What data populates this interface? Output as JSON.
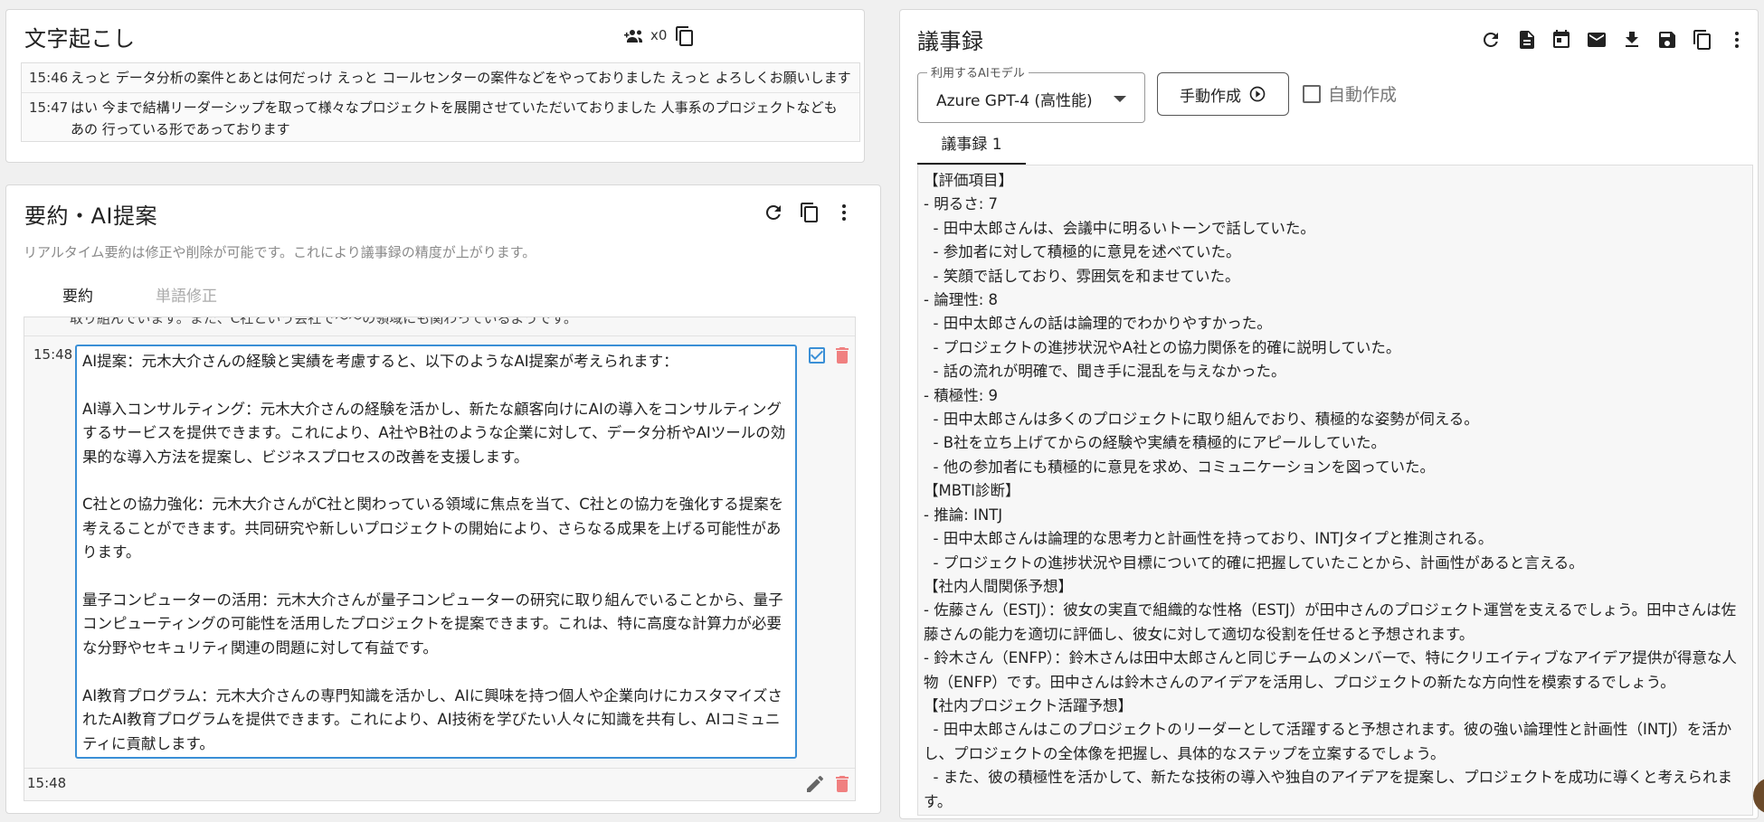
{
  "transcript": {
    "title": "文字起こし",
    "speaker_count": "x0",
    "rows": [
      {
        "time": "15:46",
        "text": "えっと データ分析の案件とあとは何だっけ えっと コールセンターの案件などをやっておりました えっと よろしくお願いします"
      },
      {
        "time": "15:47",
        "text": "はい 今まで結構リーダーシップを取って様々なプロジェクトを展開させていただいておりました 人事系のプロジェクトなども あの 行っている形であっております"
      }
    ]
  },
  "summary": {
    "title": "要約・AI提案",
    "subtitle": "リアルタイム要約は修正や削除が可能です。これにより議事録の精度が上がります。",
    "tabs": [
      {
        "label": "要約"
      },
      {
        "label": "単語修正"
      }
    ],
    "cut_text": "取り組んでいます。また、C社という会社で〜〜の領域にも関わっているようです。",
    "editing": {
      "time": "15:48",
      "text": "AI提案：元木大介さんの経験と実績を考慮すると、以下のようなAI提案が考えられます：\n\nAI導入コンサルティング：元木大介さんの経験を活かし、新たな顧客向けにAIの導入をコンサルティングするサービスを提供できます。これにより、A社やB社のような企業に対して、データ分析やAIツールの効果的な導入方法を提案し、ビジネスプロセスの改善を支援します。\n\nC社との協力強化：元木大介さんがC社と関わっている領域に焦点を当て、C社との協力を強化する提案を考えることができます。共同研究や新しいプロジェクトの開始により、さらなる成果を上げる可能性があります。\n\n量子コンピューターの活用：元木大介さんが量子コンピューターの研究に取り組んでいることから、量子コンピューティングの可能性を活用したプロジェクトを提案できます。これは、特に高度な計算力が必要な分野やセキュリティ関連の問題に対して有益です。\n\nAI教育プログラム：元木大介さんの専門知識を活かし、AIに興味を持つ個人や企業向けにカスタマイズされたAI教育プログラムを提供できます。これにより、AI技術を学びたい人々に知識を共有し、AIコミュニティに貢献します。"
    },
    "next_time": "15:48"
  },
  "minutes": {
    "title": "議事録",
    "model_label": "利用するAIモデル",
    "model_value": "Azure GPT-4 (高性能)",
    "manual_button": "手動作成",
    "auto_label": "自動作成",
    "tab_label": "議事録 1",
    "lines": [
      "【評価項目】",
      "- 明るさ: 7",
      "  - 田中太郎さんは、会議中に明るいトーンで話していた。",
      "  - 参加者に対して積極的に意見を述べていた。",
      "  - 笑顔で話しており、雰囲気を和ませていた。",
      "- 論理性: 8",
      "  - 田中太郎さんの話は論理的でわかりやすかった。",
      "  - プロジェクトの進捗状況やA社との協力関係を的確に説明していた。",
      "  - 話の流れが明確で、聞き手に混乱を与えなかった。",
      "- 積極性: 9",
      "  - 田中太郎さんは多くのプロジェクトに取り組んでおり、積極的な姿勢が伺える。",
      "  - B社を立ち上げてからの経験や実績を積極的にアピールしていた。",
      "  - 他の参加者にも積極的に意見を求め、コミュニケーションを図っていた。",
      "【MBTI診断】",
      "- 推論: INTJ",
      "  - 田中太郎さんは論理的な思考力と計画性を持っており、INTJタイプと推測される。",
      "  - プロジェクトの進捗状況や目標について的確に把握していたことから、計画性があると言える。",
      "【社内人間関係予想】",
      "- 佐藤さん（ESTJ）：彼女の実直で組織的な性格（ESTJ）が田中さんのプロジェクト運営を支えるでしょう。田中さんは佐藤さんの能力を適切に評価し、彼女に対して適切な役割を任せると予想されます。",
      "- 鈴木さん（ENFP）：鈴木さんは田中太郎さんと同じチームのメンバーで、特にクリエイティブなアイデア提供が得意な人物（ENFP）です。田中さんは鈴木さんのアイデアを活用し、プロジェクトの新たな方向性を模索するでしょう。",
      "【社内プロジェクト活躍予想】",
      "  - 田中太郎さんはこのプロジェクトのリーダーとして活躍すると予想されます。彼の強い論理性と計画性（INTJ）を活かし、プロジェクトの全体像を把握し、具体的なステップを立案するでしょう。",
      "  - また、彼の積極性を活かして、新たな技術の導入や独自のアイデアを提案し、プロジェクトを成功に導くと考えられます。"
    ]
  }
}
